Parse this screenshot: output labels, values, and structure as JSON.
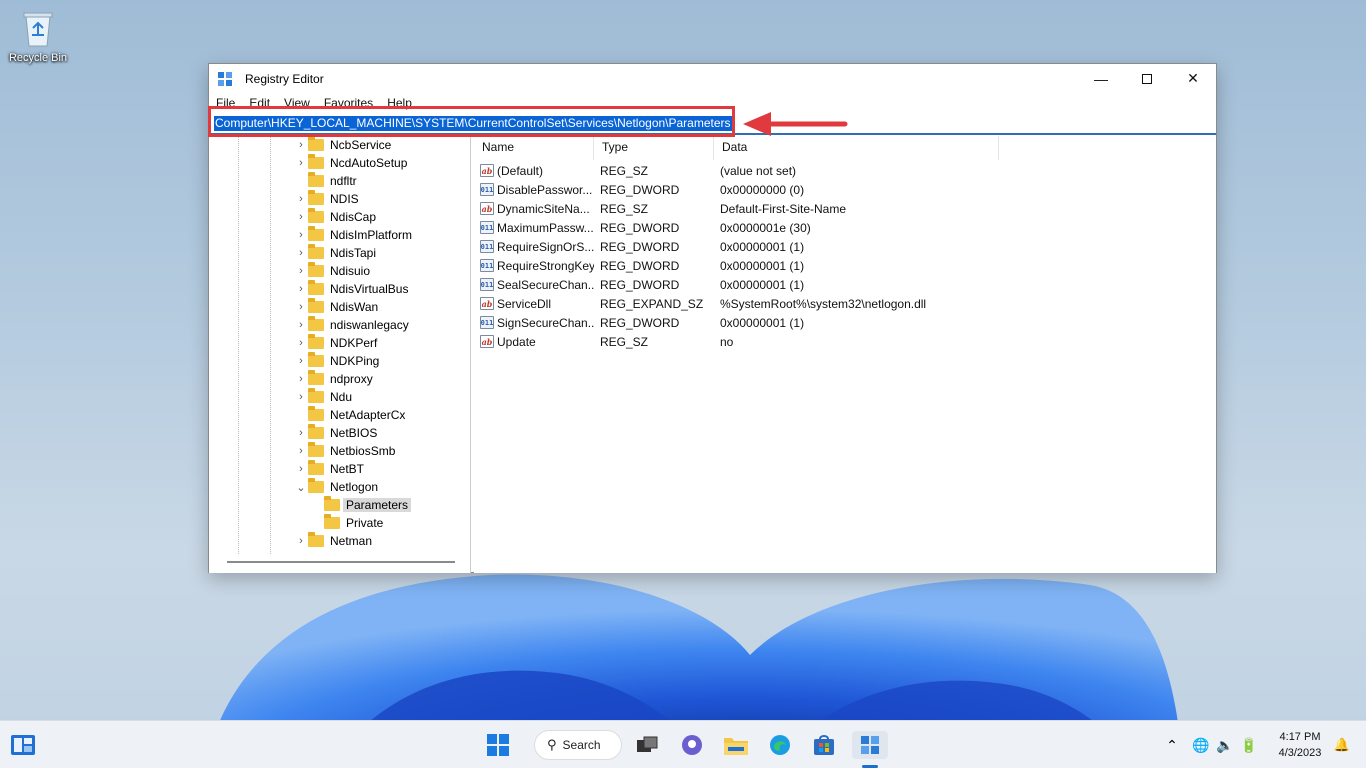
{
  "desktop": {
    "recycle_bin_label": "Recycle Bin"
  },
  "window": {
    "title": "Registry Editor",
    "menu": [
      "File",
      "Edit",
      "View",
      "Favorites",
      "Help"
    ],
    "address": "Computer\\HKEY_LOCAL_MACHINE\\SYSTEM\\CurrentControlSet\\Services\\Netlogon\\Parameters"
  },
  "tree": {
    "items": [
      {
        "label": "NcbService",
        "expandable": true,
        "level": 1
      },
      {
        "label": "NcdAutoSetup",
        "expandable": true,
        "level": 1
      },
      {
        "label": "ndfltr",
        "expandable": false,
        "level": 1
      },
      {
        "label": "NDIS",
        "expandable": true,
        "level": 1
      },
      {
        "label": "NdisCap",
        "expandable": true,
        "level": 1
      },
      {
        "label": "NdisImPlatform",
        "expandable": true,
        "level": 1
      },
      {
        "label": "NdisTapi",
        "expandable": true,
        "level": 1
      },
      {
        "label": "Ndisuio",
        "expandable": true,
        "level": 1
      },
      {
        "label": "NdisVirtualBus",
        "expandable": true,
        "level": 1
      },
      {
        "label": "NdisWan",
        "expandable": true,
        "level": 1
      },
      {
        "label": "ndiswanlegacy",
        "expandable": true,
        "level": 1
      },
      {
        "label": "NDKPerf",
        "expandable": true,
        "level": 1
      },
      {
        "label": "NDKPing",
        "expandable": true,
        "level": 1
      },
      {
        "label": "ndproxy",
        "expandable": true,
        "level": 1
      },
      {
        "label": "Ndu",
        "expandable": true,
        "level": 1
      },
      {
        "label": "NetAdapterCx",
        "expandable": false,
        "level": 1
      },
      {
        "label": "NetBIOS",
        "expandable": true,
        "level": 1
      },
      {
        "label": "NetbiosSmb",
        "expandable": true,
        "level": 1
      },
      {
        "label": "NetBT",
        "expandable": true,
        "level": 1
      },
      {
        "label": "Netlogon",
        "expandable": true,
        "expanded": true,
        "level": 1
      },
      {
        "label": "Parameters",
        "expandable": false,
        "level": 2,
        "selected": true
      },
      {
        "label": "Private",
        "expandable": false,
        "level": 2
      },
      {
        "label": "Netman",
        "expandable": true,
        "level": 1
      }
    ]
  },
  "list": {
    "columns": [
      "Name",
      "Type",
      "Data"
    ],
    "rows": [
      {
        "name": "(Default)",
        "type": "REG_SZ",
        "data": "(value not set)",
        "icon": "string-value-icon"
      },
      {
        "name": "DisablePasswor...",
        "type": "REG_DWORD",
        "data": "0x00000000 (0)",
        "icon": "binary-value-icon"
      },
      {
        "name": "DynamicSiteNa...",
        "type": "REG_SZ",
        "data": "Default-First-Site-Name",
        "icon": "string-value-icon"
      },
      {
        "name": "MaximumPassw...",
        "type": "REG_DWORD",
        "data": "0x0000001e (30)",
        "icon": "binary-value-icon"
      },
      {
        "name": "RequireSignOrS...",
        "type": "REG_DWORD",
        "data": "0x00000001 (1)",
        "icon": "binary-value-icon"
      },
      {
        "name": "RequireStrongKey",
        "type": "REG_DWORD",
        "data": "0x00000001 (1)",
        "icon": "binary-value-icon"
      },
      {
        "name": "SealSecureChan...",
        "type": "REG_DWORD",
        "data": "0x00000001 (1)",
        "icon": "binary-value-icon"
      },
      {
        "name": "ServiceDll",
        "type": "REG_EXPAND_SZ",
        "data": "%SystemRoot%\\system32\\netlogon.dll",
        "icon": "string-value-icon"
      },
      {
        "name": "SignSecureChan...",
        "type": "REG_DWORD",
        "data": "0x00000001 (1)",
        "icon": "binary-value-icon"
      },
      {
        "name": "Update",
        "type": "REG_SZ",
        "data": "no",
        "icon": "string-value-icon"
      }
    ]
  },
  "taskbar": {
    "search_label": "Search",
    "time": "4:17 PM",
    "date": "4/3/2023"
  },
  "colors": {
    "selection": "#0a64d6",
    "annotation_red": "#e0393e"
  }
}
